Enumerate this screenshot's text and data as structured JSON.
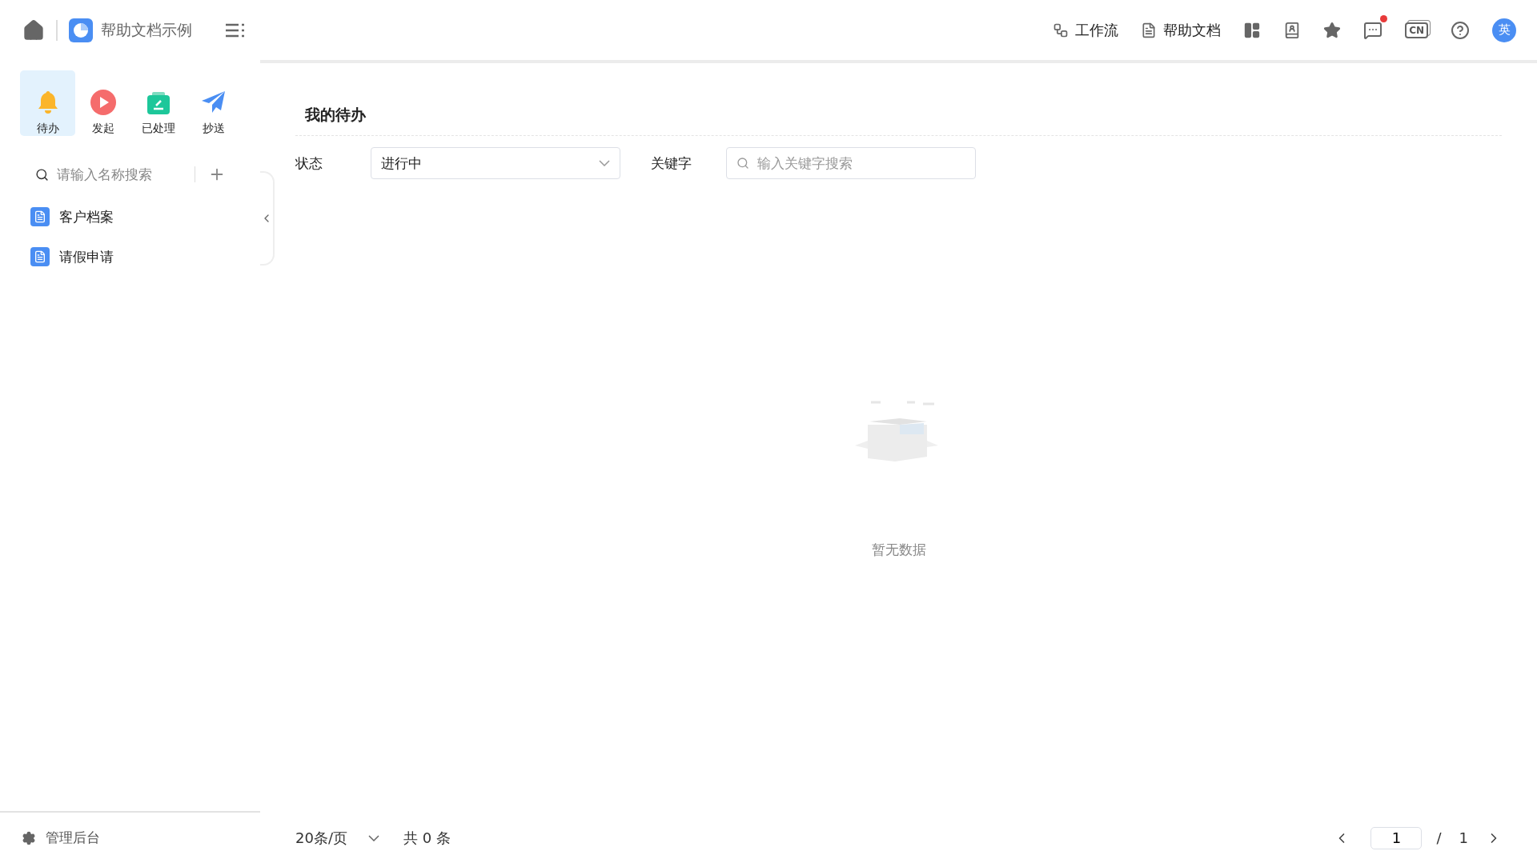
{
  "header": {
    "app_name": "帮助文档示例",
    "links": [
      {
        "kind": "workflow",
        "label": "工作流"
      },
      {
        "kind": "doc",
        "label": "帮助文档"
      }
    ],
    "chat_unread": true,
    "language_badge": "CN",
    "avatar": "英"
  },
  "sidebar": {
    "tabs": [
      {
        "kind": "bell",
        "label": "待办",
        "selected": true
      },
      {
        "kind": "play",
        "label": "发起",
        "selected": false
      },
      {
        "kind": "done",
        "label": "已处理",
        "selected": false
      },
      {
        "kind": "send",
        "label": "抄送",
        "selected": false
      }
    ],
    "search": {
      "placeholder": "请输入名称搜索"
    },
    "items": [
      {
        "label": "客户档案"
      },
      {
        "label": "请假申请"
      }
    ],
    "footer": "管理后台"
  },
  "main": {
    "title": "我的待办",
    "filters": [
      {
        "kind": "select",
        "label": "状态",
        "value": "进行中"
      },
      {
        "kind": "search",
        "label": "关键字",
        "placeholder": "输入关键字搜索"
      }
    ],
    "empty_text": "暂无数据",
    "pagination": {
      "page_size": "20条/页",
      "total": "共 0 条",
      "current": "1",
      "separator": "/",
      "pages": "1"
    }
  }
}
